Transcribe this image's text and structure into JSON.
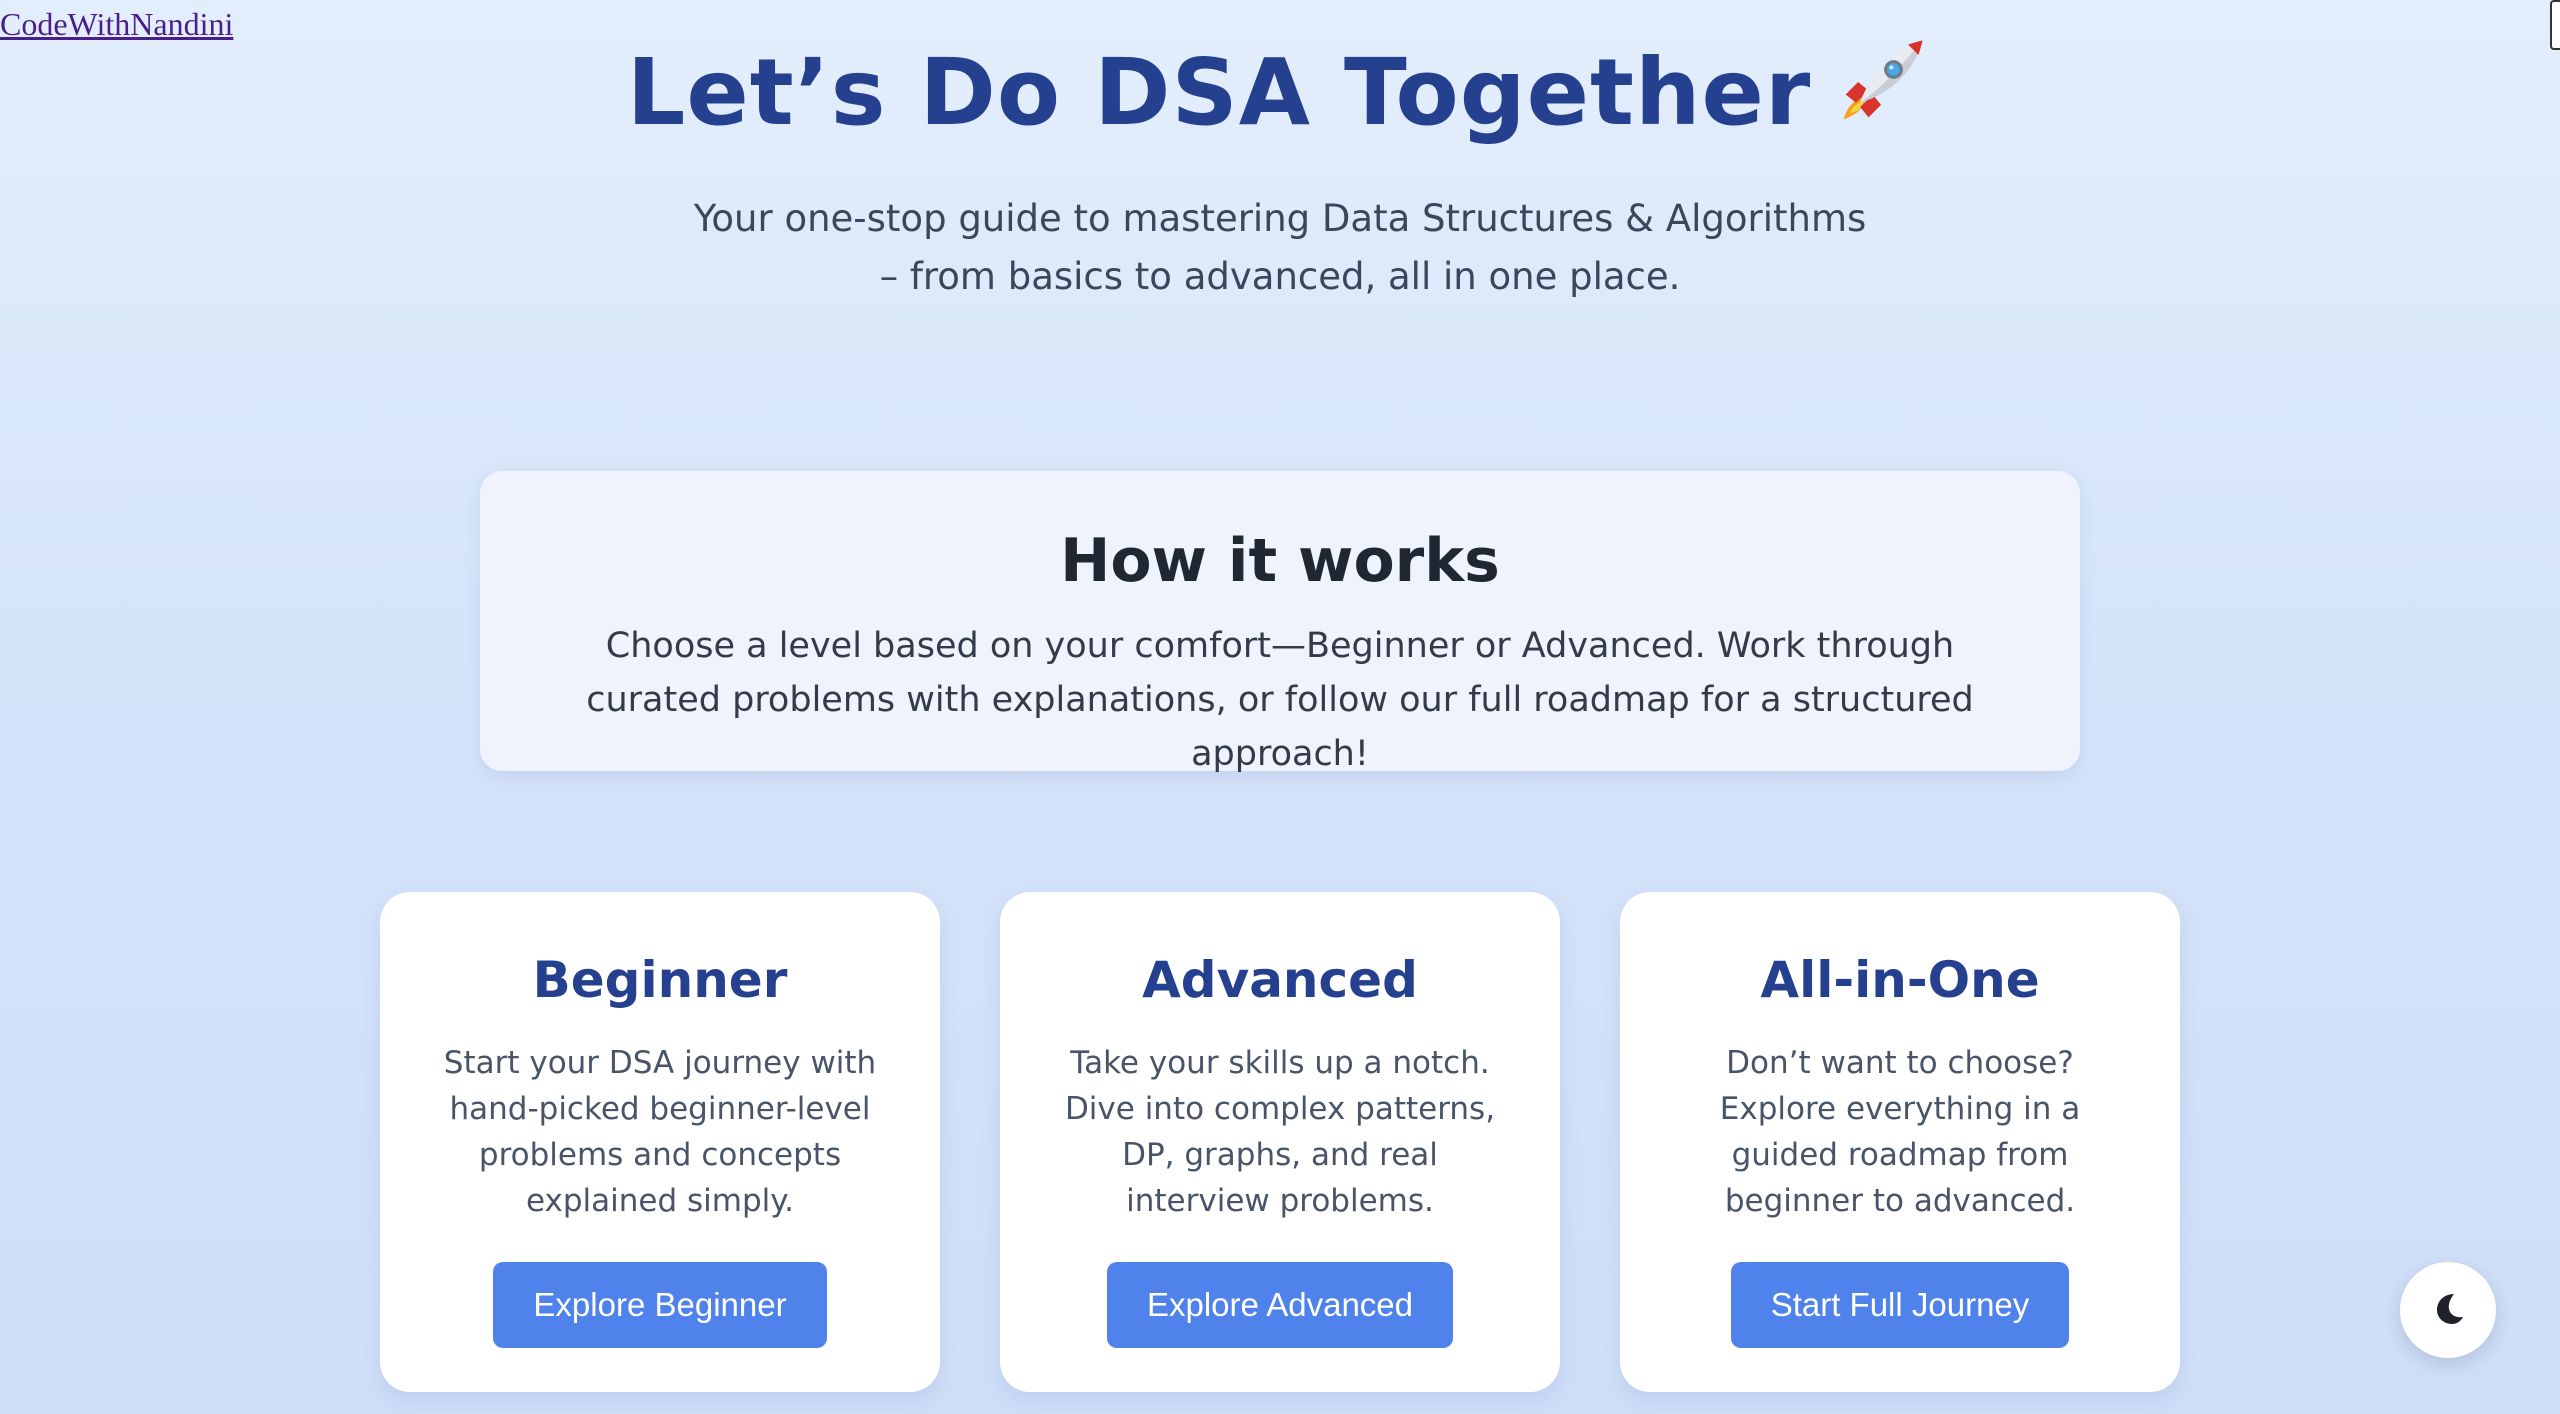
{
  "brand": {
    "link_text": "CodeWithNandini"
  },
  "hero": {
    "title": "Let’s Do DSA Together",
    "icon": "rocket-icon",
    "subtitle_line1": "Your one-stop guide to mastering Data Structures & Algorithms",
    "subtitle_line2": "– from basics to advanced, all in one place."
  },
  "how_it_works": {
    "title": "How it works",
    "text": "Choose a level based on your comfort—Beginner or Advanced. Work through curated problems with explanations, or follow our full roadmap for a structured approach!"
  },
  "levels": [
    {
      "title": "Beginner",
      "description": "Start your DSA journey with hand-picked beginner-level problems and concepts explained simply.",
      "button_label": "Explore Beginner"
    },
    {
      "title": "Advanced",
      "description": "Take your skills up a notch. Dive into complex patterns, DP, graphs, and real interview problems.",
      "button_label": "Explore Advanced"
    },
    {
      "title": "All-in-One",
      "description": "Don’t want to choose? Explore everything in a guided roadmap from beginner to advanced.",
      "button_label": "Start Full Journey"
    }
  ],
  "theme_toggle": {
    "icon": "moon-icon"
  },
  "colors": {
    "accent": "#4f82ea",
    "heading": "#25408f",
    "background": "#d6e4fa"
  }
}
